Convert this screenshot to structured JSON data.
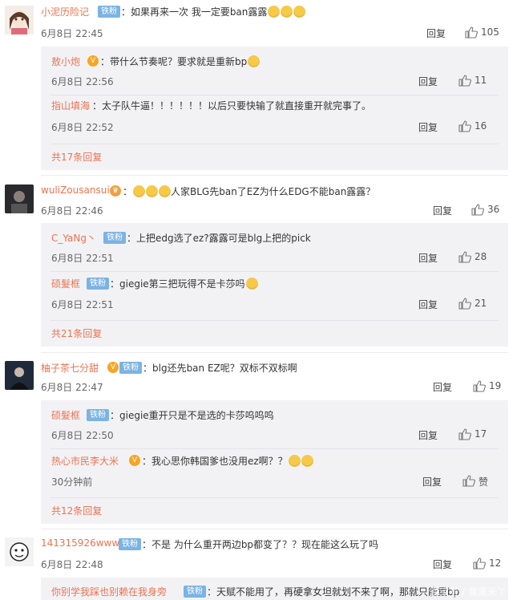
{
  "ui": {
    "reply_label": "回复",
    "like_placeholder": "赞"
  },
  "comments": [
    {
      "user": "小泥历险记",
      "badge": "铁粉",
      "text": "：如果再来一次 我一定要ban露露",
      "time": "6月8日 22:45",
      "likes": "105",
      "replies": [
        {
          "user": "敖小炮",
          "text": "：带什么节奏呢？要求就是重新bp",
          "time": "6月8日 22:56",
          "likes": "11"
        },
        {
          "user": "指山填海",
          "text": "：太子队牛逼！！！！！！以后只要快输了就直接重开就完事了。",
          "time": "6月8日 22:52",
          "likes": "16"
        }
      ],
      "more": "共17条回复"
    },
    {
      "user": "wuliZousansui",
      "text": "：",
      "text2": "人家BLG先ban了EZ为什么EDG不能ban露露？",
      "time": "6月8日 22:46",
      "likes": "36",
      "replies": [
        {
          "user": "C_YaNg丶",
          "badge": "铁粉",
          "text": "：上把edg选了ez?露露可是blg上把的pick",
          "time": "6月8日 22:51",
          "likes": "28"
        },
        {
          "user": "硕髮框",
          "badge": "铁粉",
          "text": "：giegie第三把玩得不是卡莎吗",
          "time": "6月8日 22:51",
          "likes": "21"
        }
      ],
      "more": "共21条回复"
    },
    {
      "user": "柚子茶七分甜",
      "badge": "铁粉",
      "text": "：blg还先ban EZ呢？双标不双标啊",
      "time": "6月8日 22:47",
      "likes": "19",
      "replies": [
        {
          "user": "硕髮框",
          "badge": "铁粉",
          "text": "：giegie重开只是不是选的卡莎呜呜呜",
          "time": "6月8日 22:50",
          "likes": "17"
        },
        {
          "user": "热心市民李大米",
          "text": "：我心思你韩国爹也没用ez啊？？",
          "time": "30分钟前",
          "likes": "赞"
        }
      ],
      "more": "共12条回复"
    },
    {
      "user": "141315926www",
      "badge": "铁粉",
      "text": "：不是 为什么重开两边bp都变了？？现在能这么玩了吗",
      "time": "6月8日 22:48",
      "likes": "12",
      "replies": [
        {
          "user": "你别学我踩也别赖在我身旁",
          "badge": "铁粉",
          "text": "：天赋不能用了，再硬拿女坦就划不来了啊，那就只能重bp"
        }
      ]
    }
  ],
  "watermark": "百家号 / 黄黑米丫",
  "colors": {
    "username": "#eb7350",
    "badge": "#7bb3e3",
    "subbox": "#f2f2f5",
    "text": "#333333"
  }
}
